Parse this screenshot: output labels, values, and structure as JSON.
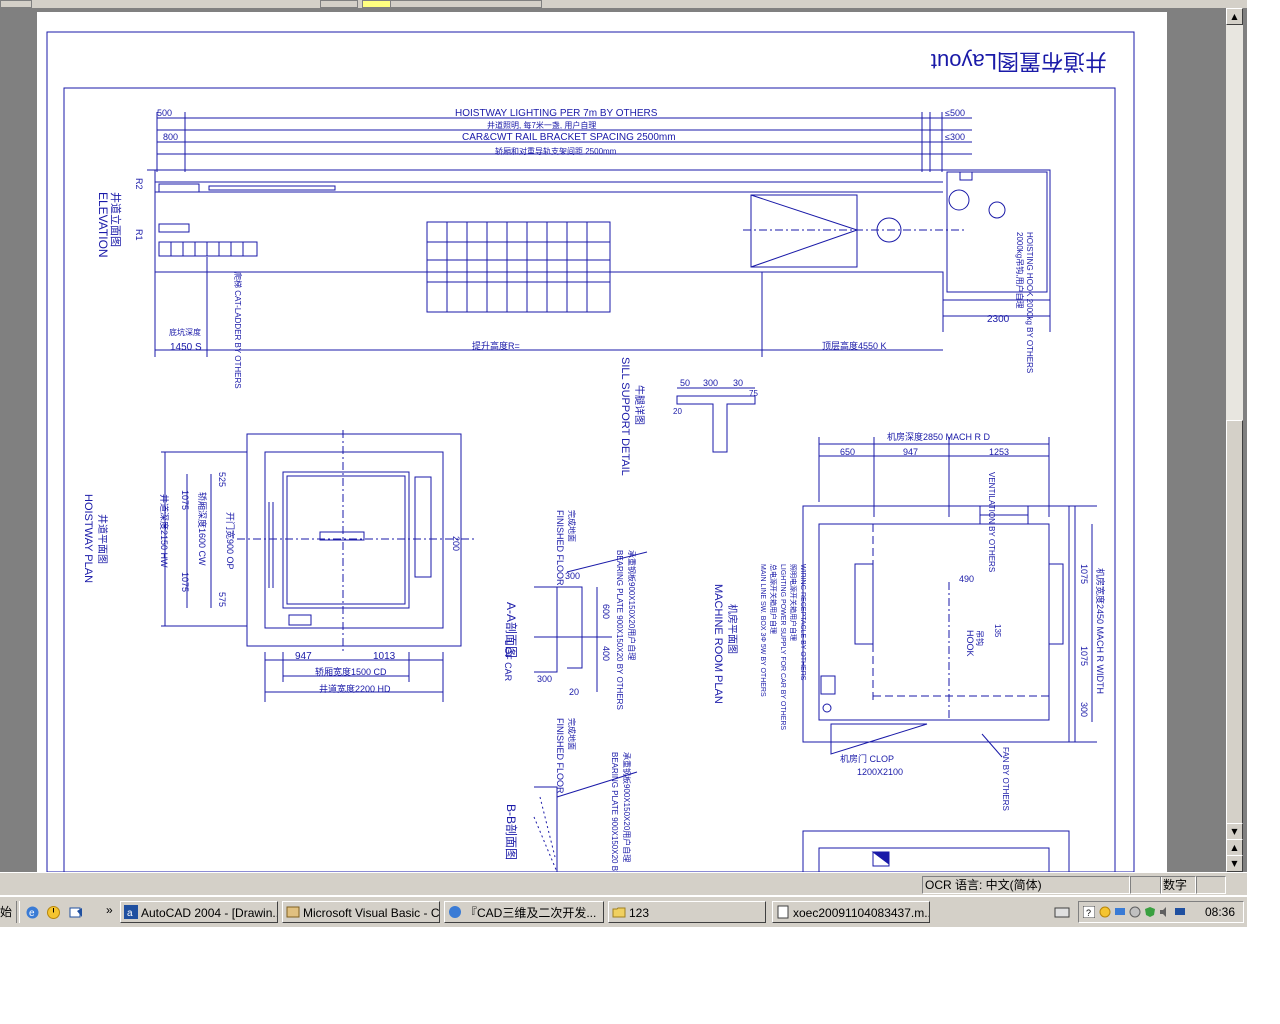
{
  "drawing": {
    "sheet_title": "井道布置图Layout",
    "hoistway_lighting": "HOISTWAY LIGHTING PER 7m BY OTHERS",
    "lighting_cn": "井道照明, 每7米一盏, 用户自理",
    "rail_bracket": "CAR&CWT RAIL BRACKET SPACING 2500mm",
    "rail_bracket_cn": "轿厢和对重导轨支架间距 2500mm",
    "dim_500": "500",
    "dim_800": "800",
    "dim_le500": "≤500",
    "dim_le300": "≤300",
    "elevation_label": "ELEVATION",
    "elevation_cn": "井道立面图",
    "label_r2": "R2",
    "label_r1": "R1",
    "hoisting_hook": "HOISTING HOOK 2000kg BY OTHERS",
    "hoisting_hook_cn": "2000kg吊钩,用户自理",
    "dim_2300": "2300",
    "pit_depth": "底坑深度",
    "dim_1450": "1450 S",
    "rise": "提升高度R=",
    "overhead": "顶层高度4550 K",
    "cat_ladder": "爬梯 CAT-LADDER BY OTHERS",
    "sill_support": "SILL SUPPORT DETAIL",
    "sill_support_cn": "牛腿详图",
    "sill_dims": [
      "50",
      "300",
      "30",
      "75",
      "20"
    ],
    "hoistway_plan": "HOISTWAY PLAN",
    "hoistway_plan_cn": "井道平面图",
    "plan_dims": {
      "d525": "525",
      "d575": "575",
      "d1075a": "1075",
      "d1075b": "1075",
      "hw": "井道深度2150 HW",
      "cw": "轿厢深度1600 CW",
      "op": "开门宽900 OP",
      "d947": "947",
      "d1013": "1013",
      "cd": "轿厢宽度1500 CD",
      "hd": "井道宽度2200 HD",
      "d200": "200"
    },
    "section_aa": "A-A剖面图",
    "section_bb": "B-B剖面图",
    "finished_floor": "FINISHED FLOOR",
    "finished_floor_cn": "完成地面",
    "bearing_plate": "BEARING PLATE 900X150X20 BY OTHERS",
    "bearing_plate_cn": "承重钢板900X150X20用户自理",
    "sec_dims": [
      "300",
      "600",
      "400",
      "300",
      "20"
    ],
    "l_of_car": "L OF CAR",
    "machine_room": "MACHINE ROOM PLAN",
    "machine_room_cn": "机房平面图",
    "mach_rd": "机房深度2850 MACH R D",
    "mach_dims": [
      "650",
      "947",
      "1253"
    ],
    "mach_width": "机房宽度2450 MACH R WIDTH",
    "mach_side_dims": [
      "1075",
      "1075",
      "300"
    ],
    "ventilation": "VENTILATION BY OTHERS",
    "hook": "HOOK",
    "hook_cn": "吊钩",
    "dim_490": "490",
    "dim_135": "135",
    "main_power": "MAIN LINE SW. BOX 3Φ 5W BY OTHERS",
    "power_notes": [
      "总电源开关箱用户自理",
      "LIGHTING POWER SUPPLY FOR CAR BY OTHERS",
      "照明电源开关箱用户自理",
      "WIRING RECEPTACLE BY OTHERS"
    ],
    "door_clop": "机房门 CLOP",
    "door_size": "1200X2100",
    "fan": "FAN BY OTHERS"
  },
  "statusbar": {
    "ocr_lang": "OCR 语言: 中文(简体)",
    "num": "数字"
  },
  "taskbar": {
    "start_fragment": "始",
    "items": [
      {
        "label": "AutoCAD 2004 - [Drawin..."
      },
      {
        "label": "Microsoft Visual Basic - C..."
      },
      {
        "label": "『CAD三维及二次开发..."
      },
      {
        "label": "123"
      },
      {
        "label": "xoec20091104083437.m..."
      }
    ],
    "chevron": "»",
    "clock": "08:36"
  },
  "scrollbar": {
    "up": "▲",
    "down": "▼",
    "prev_page": "▲",
    "next_page": "▼"
  }
}
